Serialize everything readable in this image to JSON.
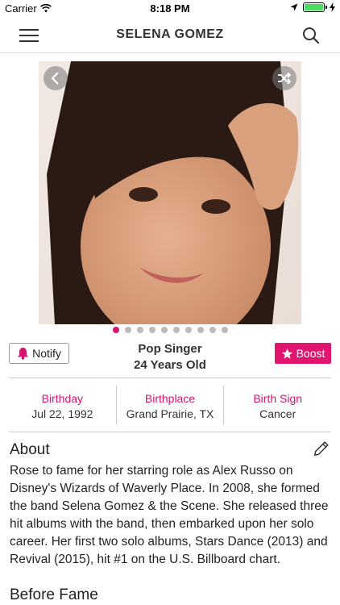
{
  "status_bar": {
    "carrier": "Carrier",
    "time": "8:18 PM"
  },
  "nav": {
    "title": "SELENA GOMEZ",
    "menu_icon": "hamburger-menu-icon",
    "search_icon": "search-icon"
  },
  "gallery": {
    "prev_icon": "chevron-left-icon",
    "shuffle_icon": "shuffle-icon",
    "dot_count": 10,
    "active_dot": 0
  },
  "actions": {
    "notify_label": "Notify",
    "boost_label": "Boost"
  },
  "profile": {
    "profession": "Pop Singer",
    "age": "24 Years Old"
  },
  "stats": [
    {
      "label": "Birthday",
      "value": "Jul 22, 1992"
    },
    {
      "label": "Birthplace",
      "value": "Grand Prairie, TX"
    },
    {
      "label": "Birth Sign",
      "value": "Cancer"
    }
  ],
  "about": {
    "title": "About",
    "text": "Rose to fame for her starring role as Alex Russo on Disney's Wizards of Waverly Place. In 2008, she formed the band Selena Gomez & the Scene. She released three hit albums with the band, then embarked upon her solo career. Her first two solo albums, Stars Dance (2013) and Revival (2015), hit #1 on the U.S. Billboard chart."
  },
  "before_fame": {
    "title": "Before Fame"
  },
  "colors": {
    "accent": "#d6146f",
    "boost": "#e0166e",
    "battery": "#4cd964"
  }
}
